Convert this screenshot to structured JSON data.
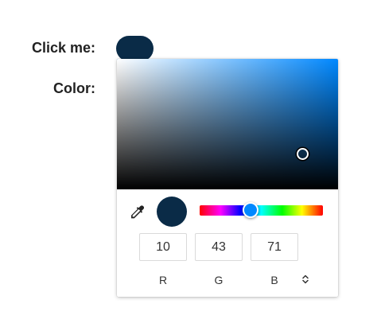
{
  "form": {
    "click_label": "Click me:",
    "color_label": "Color:"
  },
  "color": {
    "hex": "#0a2b47",
    "hue_hex": "#0088ff",
    "hue_fraction": 0.412
  },
  "picker": {
    "r_value": "10",
    "g_value": "43",
    "b_value": "71",
    "r_label": "R",
    "g_label": "G",
    "b_label": "B"
  },
  "icons": {
    "eyedropper": "eyedropper-icon",
    "mode_toggle": "chevron-updown-icon"
  }
}
